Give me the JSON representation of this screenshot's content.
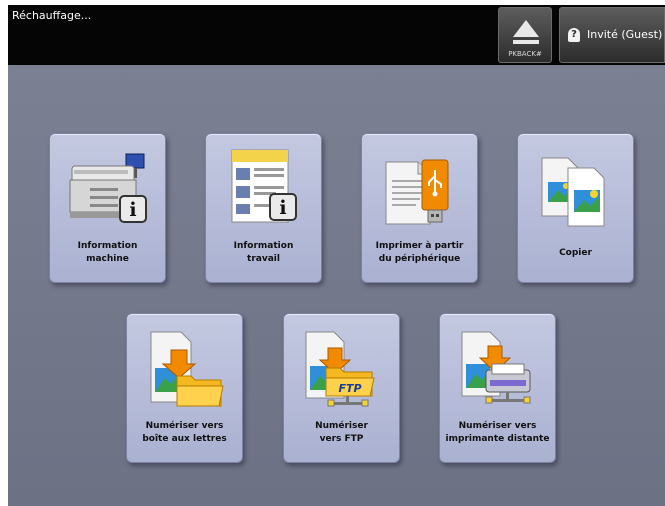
{
  "topbar": {
    "status": "Réchauffage...",
    "pkback_label": "PKBACK#",
    "guest_label": "Invité (Guest)"
  },
  "tiles": [
    {
      "label": "Information\nmachine",
      "icon": "machine-info-icon"
    },
    {
      "label": "Information\ntravail",
      "icon": "job-info-icon"
    },
    {
      "label": "Imprimer à partir\ndu périphérique",
      "icon": "usb-print-icon"
    },
    {
      "label": "Copier",
      "icon": "copy-icon"
    },
    {
      "label": "Numériser vers\nboîte aux lettres",
      "icon": "scan-to-mailbox-icon"
    },
    {
      "label": "Numériser\nvers FTP",
      "icon": "scan-to-ftp-icon"
    },
    {
      "label": "Numériser vers\nimprimante distante",
      "icon": "scan-to-remote-printer-icon"
    }
  ],
  "icon_texts": {
    "ftp": "FTP",
    "info": "i",
    "guest": "?"
  },
  "colors": {
    "topbar": "#050505",
    "background": "#737889",
    "tile": "#b8bedb",
    "accent_orange": "#f28a00"
  }
}
